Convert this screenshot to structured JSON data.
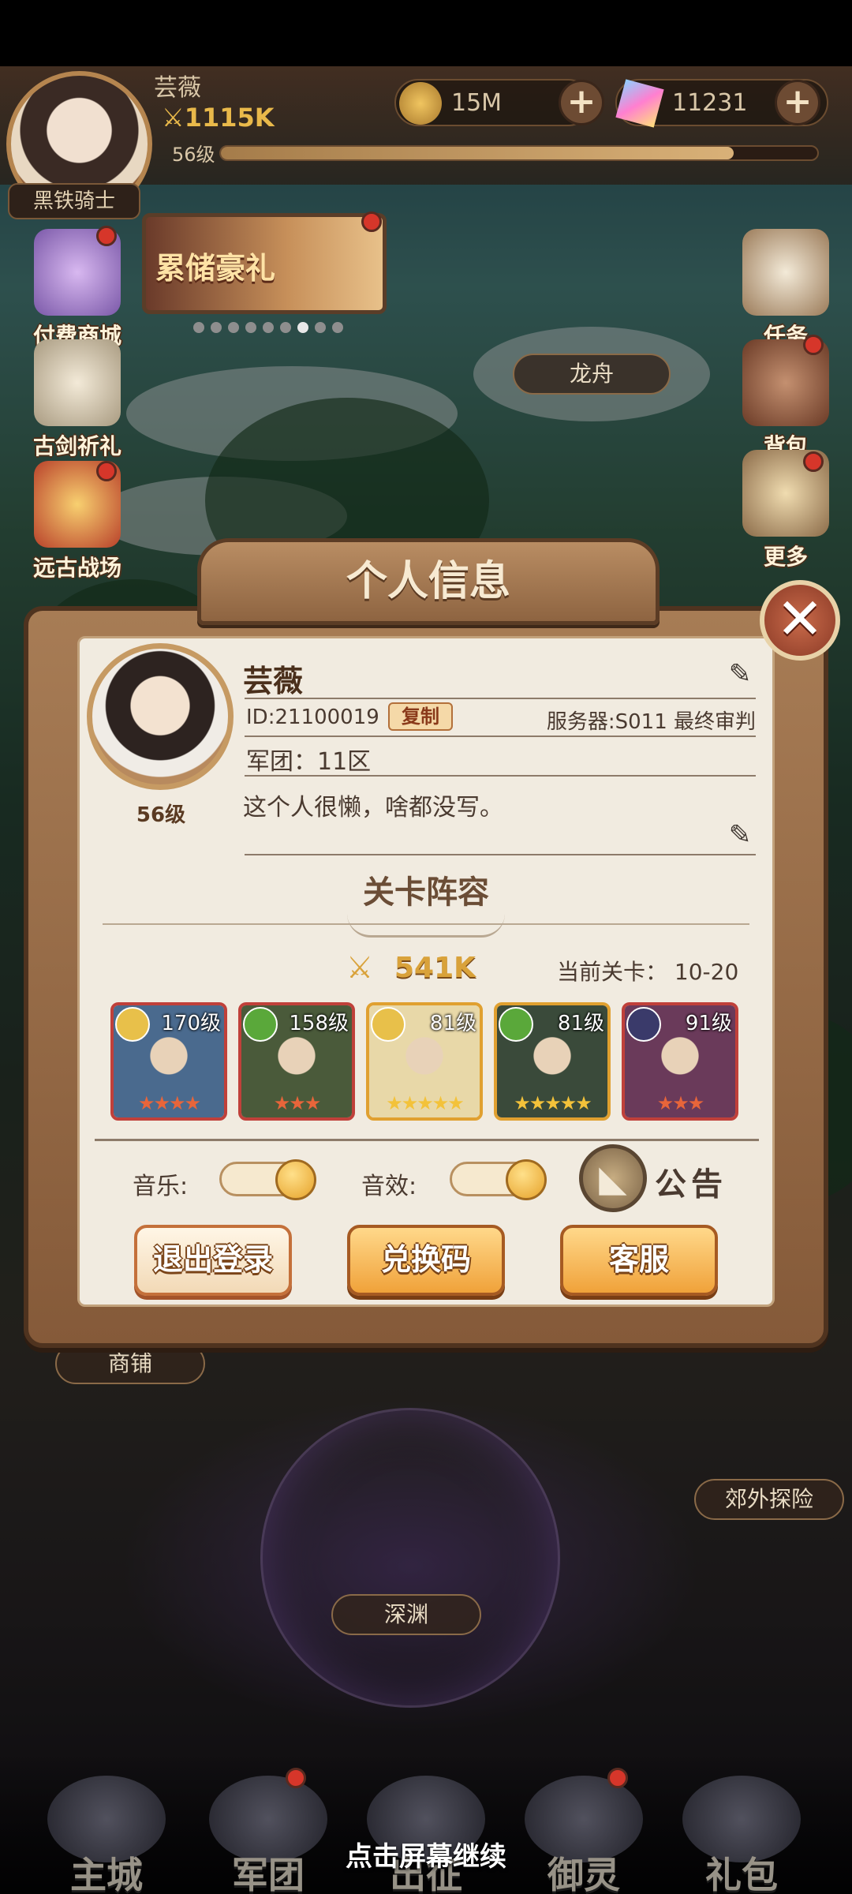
{
  "status_bar": {},
  "hud": {
    "player_name": "芸薇",
    "power": "1115K",
    "level": "56级",
    "exp_fraction": 0.86,
    "title_badge": "黑铁骑士",
    "gold": "15M",
    "gems": "11231",
    "plus_symbol": "+"
  },
  "left_menu": [
    {
      "label": "付费商城",
      "icon": "gift-icon"
    },
    {
      "label": "古剑祈礼",
      "icon": "sword-icon"
    },
    {
      "label": "远古战场",
      "icon": "battle-icon"
    }
  ],
  "right_menu": [
    {
      "label": "任务",
      "icon": "scroll-icon"
    },
    {
      "label": "背包",
      "icon": "bag-icon"
    },
    {
      "label": "更多",
      "icon": "more-icon"
    }
  ],
  "banner": {
    "label": "累储豪礼",
    "page_count": 9,
    "active_index": 6
  },
  "map_labels": {
    "dragon_boat": "龙舟",
    "shop": "商铺",
    "explore": "郊外探险",
    "abyss": "深渊"
  },
  "dialog": {
    "title": "个人信息",
    "close_symbol": "✕",
    "name": "芸薇",
    "level": "56级",
    "id": "ID:21100019",
    "copy_label": "复制",
    "server": "服务器:S011 最终审判",
    "guild": "军团：11区",
    "signature": "这个人很懒，啥都没写。",
    "lineup_title": "关卡阵容",
    "lineup_power": "541K",
    "current_stage_label": "当前关卡：",
    "current_stage": "10-20",
    "heroes": [
      {
        "level": "170级",
        "stars": "★★★★",
        "element_color": "#e8c04a",
        "frame_color": "#c0403a",
        "art": "#4a6a8e"
      },
      {
        "level": "158级",
        "stars": "★★★",
        "element_color": "#5aa83a",
        "frame_color": "#c0403a",
        "art": "#4a5a3a"
      },
      {
        "level": "81级",
        "stars": "★★★★★",
        "element_color": "#e8c04a",
        "frame_color": "#e0a030",
        "art": "#e8d8a8"
      },
      {
        "level": "81级",
        "stars": "★★★★★",
        "element_color": "#5aa83a",
        "frame_color": "#e0a030",
        "art": "#3a4a3a"
      },
      {
        "level": "91级",
        "stars": "★★★",
        "element_color": "#3a3a6a",
        "frame_color": "#c0403a",
        "art": "#6a3a5a"
      }
    ],
    "music_label": "音乐:",
    "sound_label": "音效:",
    "notice_label": "公告",
    "logout_label": "退出登录",
    "redeem_label": "兑换码",
    "support_label": "客服"
  },
  "bottom_nav": [
    {
      "label": "主城"
    },
    {
      "label": "军团"
    },
    {
      "label": "出征"
    },
    {
      "label": "御灵"
    },
    {
      "label": "礼包"
    }
  ],
  "continue_hint": "点击屏幕继续"
}
